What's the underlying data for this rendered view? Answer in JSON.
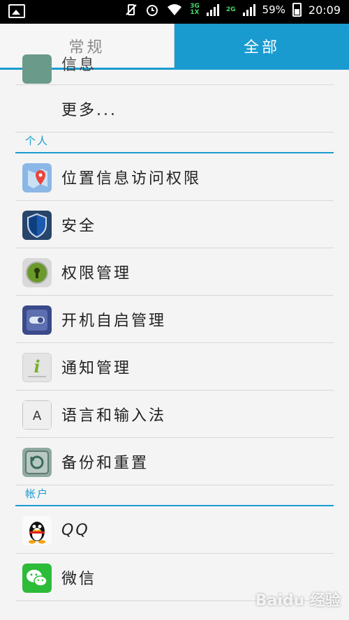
{
  "status_bar": {
    "net_top": "3G",
    "net_bottom": "1X",
    "net2": "2G",
    "battery": "59%",
    "time": "20:09"
  },
  "tabs": {
    "general": "常规",
    "all": "全部"
  },
  "partial_item": "信息",
  "more_label": "更多...",
  "sections": {
    "personal": "个人",
    "accounts": "帐户"
  },
  "personal_items": [
    {
      "label": "位置信息访问权限",
      "icon": "location-icon"
    },
    {
      "label": "安全",
      "icon": "shield-icon"
    },
    {
      "label": "权限管理",
      "icon": "lock-icon"
    },
    {
      "label": "开机自启管理",
      "icon": "toggle-icon"
    },
    {
      "label": "通知管理",
      "icon": "info-icon"
    },
    {
      "label": "语言和输入法",
      "icon": "keyboard-a-icon"
    },
    {
      "label": "备份和重置",
      "icon": "safe-icon"
    }
  ],
  "account_items": [
    {
      "label": "QQ",
      "icon": "qq-penguin-icon"
    },
    {
      "label": "微信",
      "icon": "wechat-icon"
    }
  ],
  "watermark": "Baidu 经验"
}
